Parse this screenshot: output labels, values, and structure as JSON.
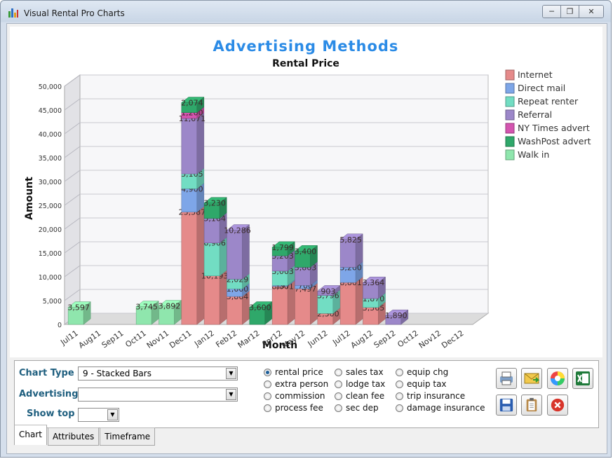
{
  "window": {
    "title": "Visual Rental Pro Charts"
  },
  "chart": {
    "title": "Advertising Methods",
    "subtitle": "Rental Price",
    "xlabel": "Month",
    "ylabel": "Amount",
    "y_ticks": [
      "0",
      "5,000",
      "10,000",
      "15,000",
      "20,000",
      "25,000",
      "30,000",
      "35,000",
      "40,000",
      "45,000",
      "50,000"
    ],
    "colors": [
      "#e58a8a",
      "#7ea6e8",
      "#72ddc3",
      "#9c87c9",
      "#d455b0",
      "#2fa86a",
      "#8fe6ad"
    ]
  },
  "chart_data": {
    "type": "bar",
    "stacked": true,
    "title": "Advertising Methods",
    "subtitle": "Rental Price",
    "xlabel": "Month",
    "ylabel": "Amount",
    "ylim": [
      0,
      50000
    ],
    "grid": true,
    "legend": "right",
    "categories": [
      "Jul11",
      "Aug11",
      "Sep11",
      "Oct11",
      "Nov11",
      "Dec11",
      "Jan12",
      "Feb12",
      "Mar12",
      "Apr12",
      "May12",
      "Jun12",
      "Jul12",
      "Aug12",
      "Sep12",
      "Oct12",
      "Nov12",
      "Dec12"
    ],
    "series": [
      {
        "name": "Internet",
        "values": [
          0,
          0,
          0,
          0,
          0,
          23587,
          10193,
          5864,
          0,
          8001,
          7497,
          2300,
          8801,
          3565,
          0,
          0,
          0,
          0
        ]
      },
      {
        "name": "Direct mail",
        "values": [
          0,
          0,
          0,
          0,
          0,
          4900,
          0,
          1600,
          0,
          197,
          700,
          0,
          3200,
          0,
          0,
          0,
          0,
          0
        ]
      },
      {
        "name": "Repeat renter",
        "values": [
          0,
          0,
          0,
          0,
          0,
          3105,
          6906,
          2029,
          0,
          3003,
          0,
          3796,
          0,
          1870,
          0,
          0,
          0,
          0
        ]
      },
      {
        "name": "Referral",
        "values": [
          0,
          0,
          0,
          0,
          0,
          11671,
          5164,
          10286,
          0,
          3203,
          3803,
          903,
          5825,
          3364,
          1890,
          0,
          0,
          0
        ]
      },
      {
        "name": "NY Times advert",
        "values": [
          0,
          0,
          0,
          0,
          0,
          1200,
          0,
          0,
          0,
          0,
          0,
          0,
          0,
          0,
          0,
          0,
          0,
          0
        ]
      },
      {
        "name": "WashPost advert",
        "values": [
          0,
          0,
          0,
          0,
          0,
          2074,
          3230,
          0,
          3600,
          1799,
          3400,
          0,
          0,
          0,
          0,
          0,
          0,
          0
        ]
      },
      {
        "name": "Walk in",
        "values": [
          3597,
          0,
          0,
          3745,
          3892,
          0,
          0,
          0,
          0,
          0,
          0,
          0,
          0,
          0,
          0,
          0,
          0,
          0
        ]
      }
    ]
  },
  "controls": {
    "chart_type_label": "Chart Type",
    "chart_type_value": "9 - Stacked Bars",
    "advertising_label": "Advertising",
    "advertising_value": "",
    "show_top_label": "Show top",
    "show_top_value": "",
    "radios": [
      {
        "label": "rental price",
        "checked": true
      },
      {
        "label": "extra person",
        "checked": false
      },
      {
        "label": "commission",
        "checked": false
      },
      {
        "label": "process fee",
        "checked": false
      },
      {
        "label": "sales tax",
        "checked": false
      },
      {
        "label": "lodge tax",
        "checked": false
      },
      {
        "label": "clean fee",
        "checked": false
      },
      {
        "label": "sec dep",
        "checked": false
      },
      {
        "label": "equip chg",
        "checked": false
      },
      {
        "label": "equip tax",
        "checked": false
      },
      {
        "label": "trip insurance",
        "checked": false
      },
      {
        "label": "damage insurance",
        "checked": false
      }
    ]
  },
  "tabs": [
    {
      "label": "Chart",
      "active": true
    },
    {
      "label": "Attributes",
      "active": false
    },
    {
      "label": "Timeframe",
      "active": false
    }
  ]
}
